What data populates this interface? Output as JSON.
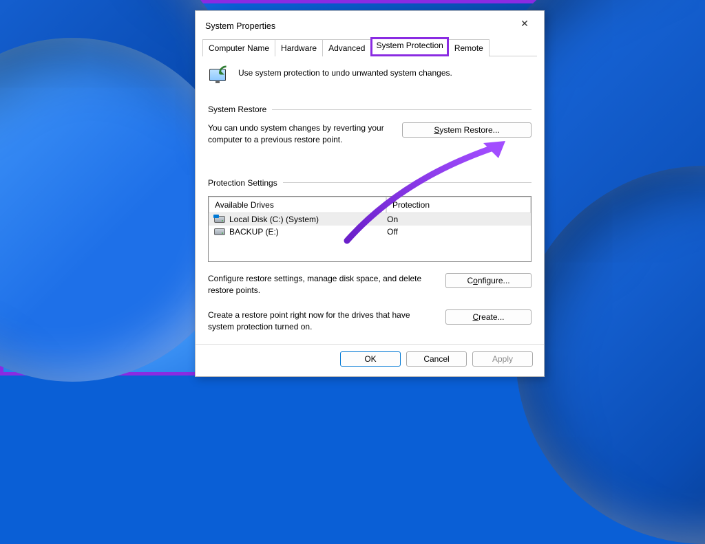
{
  "window": {
    "title": "System Properties",
    "close_icon": "✕"
  },
  "tabs": [
    {
      "label": "Computer Name"
    },
    {
      "label": "Hardware"
    },
    {
      "label": "Advanced"
    },
    {
      "label": "System Protection",
      "active": true,
      "highlighted": true
    },
    {
      "label": "Remote"
    }
  ],
  "intro_text": "Use system protection to undo unwanted system changes.",
  "section_restore": {
    "header": "System Restore",
    "desc": "You can undo system changes by reverting your computer to a previous restore point.",
    "button_label": "System Restore...",
    "button_mnemonic": "S"
  },
  "section_settings": {
    "header": "Protection Settings",
    "columns": {
      "a": "Available Drives",
      "b": "Protection"
    },
    "drives": [
      {
        "name": "Local Disk (C:) (System)",
        "protection": "On",
        "system": true,
        "selected": true
      },
      {
        "name": "BACKUP (E:)",
        "protection": "Off",
        "system": false,
        "selected": false
      }
    ],
    "configure_desc": "Configure restore settings, manage disk space, and delete restore points.",
    "configure_button": "Configure...",
    "configure_mnemonic": "o",
    "create_desc": "Create a restore point right now for the drives that have system protection turned on.",
    "create_button": "Create...",
    "create_mnemonic": "C"
  },
  "buttons": {
    "ok": "OK",
    "cancel": "Cancel",
    "apply": "Apply"
  }
}
